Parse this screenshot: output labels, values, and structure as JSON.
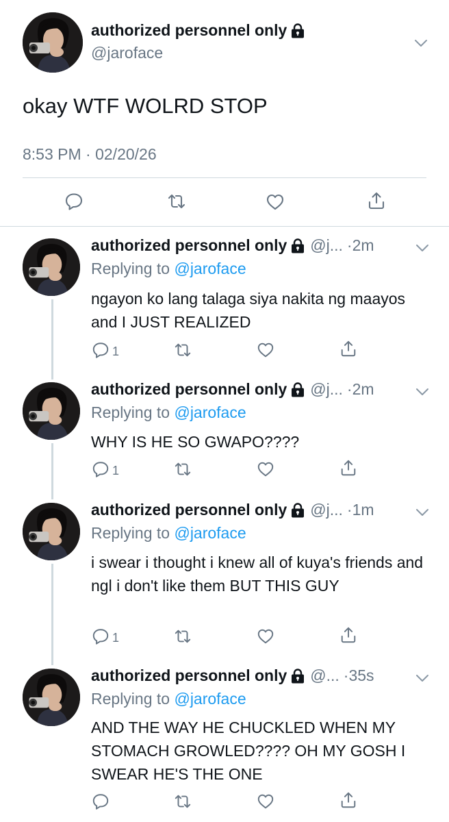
{
  "main_tweet": {
    "display_name": "authorized personnel only",
    "handle": "@jaroface",
    "text": "okay WTF WOLRD STOP",
    "timestamp": "8:53 PM · 02/20/26",
    "icons": {
      "lock": "lock-icon",
      "menu": "chevron-down-icon",
      "reply": "reply-icon",
      "retweet": "retweet-icon",
      "like": "heart-icon",
      "share": "share-icon"
    }
  },
  "replies": [
    {
      "display_name": "authorized personnel only",
      "handle": "@j...",
      "time": "·2m",
      "replying_prefix": "Replying to",
      "replying_to": "@jaroface",
      "text": "ngayon ko lang talaga siya nakita ng maayos and I JUST REALIZED",
      "reply_count": "1"
    },
    {
      "display_name": "authorized personnel only",
      "handle": "@j...",
      "time": "·2m",
      "replying_prefix": "Replying to",
      "replying_to": "@jaroface",
      "text": "WHY IS HE SO GWAPO????",
      "reply_count": "1"
    },
    {
      "display_name": "authorized personnel only",
      "handle": "@j...",
      "time": "·1m",
      "replying_prefix": "Replying to",
      "replying_to": "@jaroface",
      "text": "i swear i thought i knew all of kuya's friends and ngl i don't like them BUT THIS GUY",
      "reply_count": "1"
    },
    {
      "display_name": "authorized personnel only",
      "handle": "@...",
      "time": "·35s",
      "replying_prefix": "Replying to",
      "replying_to": "@jaroface",
      "text": "AND THE WAY HE CHUCKLED WHEN MY STOMACH GROWLED???? OH MY GOSH I SWEAR HE'S THE ONE",
      "reply_count": ""
    }
  ],
  "colors": {
    "text": "#0f1419",
    "secondary": "#687684",
    "link": "#1d9bf0",
    "divider": "#cfd9de"
  }
}
